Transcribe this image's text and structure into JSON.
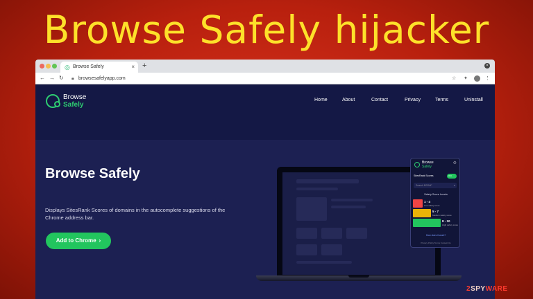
{
  "headline": "Browse Safely hijacker",
  "browser": {
    "tab_title": "Browse Safely",
    "tab_close": "×",
    "new_tab": "+",
    "url": "browsesafelyapp.com"
  },
  "site": {
    "logo_line1": "Browse",
    "logo_line2": "Safely",
    "nav": [
      "Home",
      "About",
      "Contact",
      "Privacy",
      "Terms",
      "Uninstall"
    ],
    "hero_title": "Browse Safely",
    "hero_desc": "Displays SitesRank Scores of domains in the autocomplete suggestions of the Chrome address bar.",
    "cta_label": "Add to Chrome"
  },
  "popup": {
    "brand_line1": "Browse",
    "brand_line2": "Safely",
    "sitesrank_label": "SitesRank Scores",
    "toggle_label": "ON",
    "search_placeholder": "Search BSSAF",
    "levels_title": "Safety Score Levels",
    "levels": [
      {
        "range": "1 - 4",
        "label": "Low safety score",
        "color": "#ef4444"
      },
      {
        "range": "5 - 7",
        "label": "Medium safety score",
        "color": "#eab308"
      },
      {
        "range": "8 - 10",
        "label": "High safety score",
        "color": "#22c55e"
      }
    ],
    "link": "How does it work?",
    "footer": "Privacy Policy   Terms   Contact Us"
  },
  "watermark": {
    "prefix": "2",
    "middle": "SPY",
    "suffix": "WARE"
  }
}
